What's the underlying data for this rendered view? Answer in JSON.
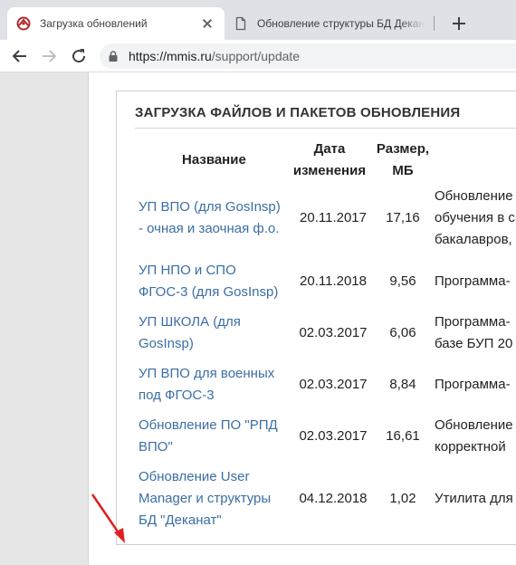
{
  "browser": {
    "tabs": [
      {
        "title": "Загрузка обновлений",
        "active": true,
        "icon": "site-logo-icon"
      },
      {
        "title": "Обновление структуры БД Деканат",
        "active": false,
        "icon": "document-icon"
      }
    ],
    "url": {
      "host": "https://mmis.ru",
      "path": "/support/update"
    }
  },
  "section": {
    "title": "ЗАГРУЗКА ФАЙЛОВ И ПАКЕТОВ ОБНОВЛЕНИЯ",
    "columns": {
      "name": "Название",
      "date_1": "Дата",
      "date_2": "изменения",
      "size_1": "Размер,",
      "size_2": "МБ"
    },
    "rows": [
      {
        "name": [
          "УП ВПО (для GosInsp)",
          "- очная и заочная ф.о."
        ],
        "date": "20.11.2017",
        "size": "17,16",
        "desc": [
          "Обновление",
          "обучения в с",
          "бакалавров,"
        ]
      },
      {
        "name": [
          "УП НПО и СПО",
          "ФГОС-3 (для GosInsp)"
        ],
        "date": "20.11.2018",
        "size": "9,56",
        "desc": [
          "Программа-"
        ]
      },
      {
        "name": [
          "УП ШКОЛА (для",
          "GosInsp)"
        ],
        "date": "02.03.2017",
        "size": "6,06",
        "desc": [
          "Программа-",
          "базе БУП 20"
        ]
      },
      {
        "name": [
          "УП ВПО для военных",
          "под ФГОС-3"
        ],
        "date": "02.03.2017",
        "size": "8,84",
        "desc": [
          "Программа-"
        ]
      },
      {
        "name": [
          "Обновление ПО \"РПД",
          "ВПО\""
        ],
        "date": "02.03.2017",
        "size": "16,61",
        "desc": [
          "Обновление",
          "корректной"
        ]
      },
      {
        "name": [
          "Обновление User",
          "Manager и структуры",
          "БД \"Деканат\""
        ],
        "date": "04.12.2018",
        "size": "1,02",
        "desc": [
          "Утилита для"
        ]
      }
    ]
  },
  "annotation": {
    "arrow_color": "#e02020"
  }
}
